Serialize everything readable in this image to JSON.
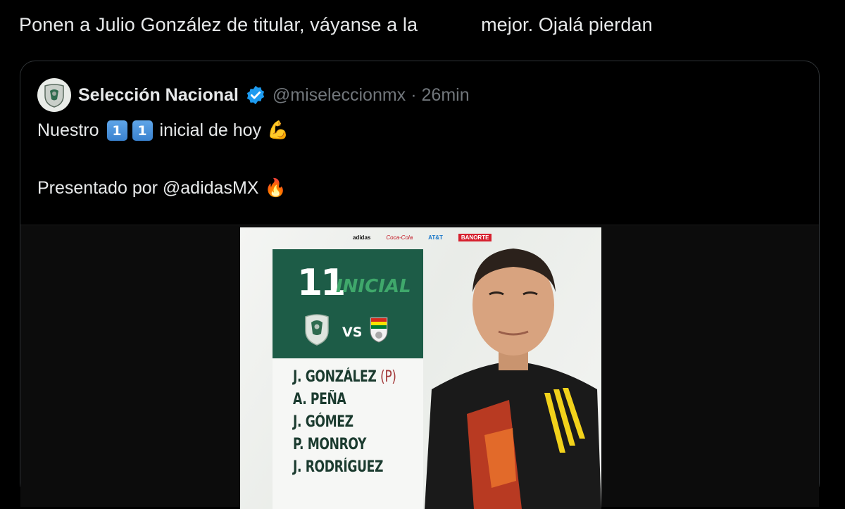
{
  "main_tweet": {
    "text_before": "Ponen a Julio González de titular, váyanse a la",
    "text_after": "mejor. Ojalá pierdan"
  },
  "quoted_tweet": {
    "name": "Selección Nacional",
    "handle": "@miseleccionmx",
    "separator": "·",
    "time": "26min",
    "line1_before": "Nuestro",
    "keycap_1": "1",
    "keycap_2": "1",
    "line1_after": "inicial de hoy",
    "line1_emoji": "💪",
    "line2_text": "Presentado por @adidasMX",
    "line2_emoji": "🔥"
  },
  "media": {
    "sponsors": [
      "adidas",
      "Coca-Cola",
      "AT&T",
      "BANORTE"
    ],
    "eleven": "11",
    "inicial": "INICIAL",
    "vs": "VS",
    "players": [
      {
        "name": "J. GONZÁLEZ",
        "pos": "(P)"
      },
      {
        "name": "A. PEÑA"
      },
      {
        "name": "J. GÓMEZ"
      },
      {
        "name": "P. MONROY"
      },
      {
        "name": "J. RODRÍGUEZ"
      }
    ]
  },
  "colors": {
    "background": "#000000",
    "verified": "#1d9bf0",
    "card_green": "#1d5c47",
    "jersey": "#1a1a1a"
  }
}
